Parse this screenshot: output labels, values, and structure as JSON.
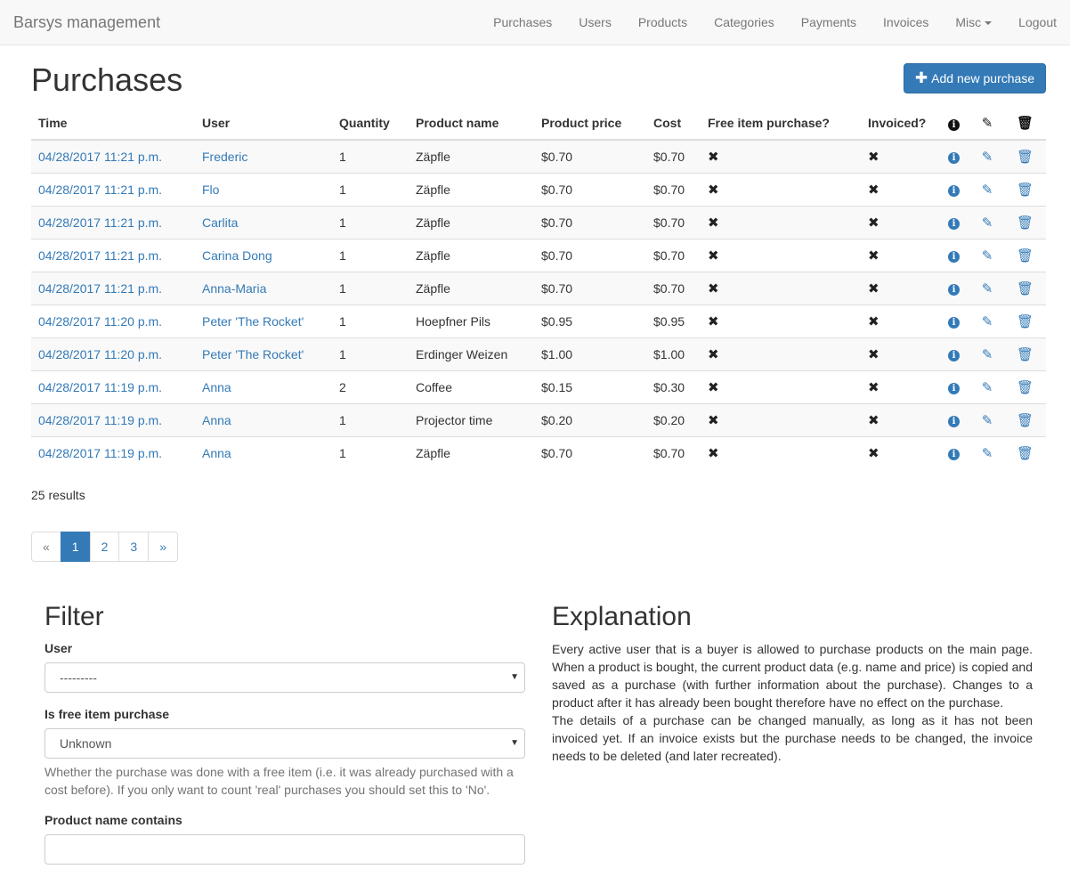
{
  "navbar": {
    "brand": "Barsys management",
    "items": [
      "Purchases",
      "Users",
      "Products",
      "Categories",
      "Payments",
      "Invoices",
      "Misc",
      "Logout"
    ]
  },
  "page": {
    "title": "Purchases",
    "add_button": "Add new purchase"
  },
  "table": {
    "headers": [
      "Time",
      "User",
      "Quantity",
      "Product name",
      "Product price",
      "Cost",
      "Free item purchase?",
      "Invoiced?"
    ],
    "rows": [
      {
        "time": "04/28/2017 11:21 p.m.",
        "user": "Frederic",
        "qty": "1",
        "product": "Zäpfle",
        "price": "$0.70",
        "cost": "$0.70"
      },
      {
        "time": "04/28/2017 11:21 p.m.",
        "user": "Flo",
        "qty": "1",
        "product": "Zäpfle",
        "price": "$0.70",
        "cost": "$0.70"
      },
      {
        "time": "04/28/2017 11:21 p.m.",
        "user": "Carlita",
        "qty": "1",
        "product": "Zäpfle",
        "price": "$0.70",
        "cost": "$0.70"
      },
      {
        "time": "04/28/2017 11:21 p.m.",
        "user": "Carina Dong",
        "qty": "1",
        "product": "Zäpfle",
        "price": "$0.70",
        "cost": "$0.70"
      },
      {
        "time": "04/28/2017 11:21 p.m.",
        "user": "Anna-Maria",
        "qty": "1",
        "product": "Zäpfle",
        "price": "$0.70",
        "cost": "$0.70"
      },
      {
        "time": "04/28/2017 11:20 p.m.",
        "user": "Peter 'The Rocket'",
        "qty": "1",
        "product": "Hoepfner Pils",
        "price": "$0.95",
        "cost": "$0.95"
      },
      {
        "time": "04/28/2017 11:20 p.m.",
        "user": "Peter 'The Rocket'",
        "qty": "1",
        "product": "Erdinger Weizen",
        "price": "$1.00",
        "cost": "$1.00"
      },
      {
        "time": "04/28/2017 11:19 p.m.",
        "user": "Anna",
        "qty": "2",
        "product": "Coffee",
        "price": "$0.15",
        "cost": "$0.30"
      },
      {
        "time": "04/28/2017 11:19 p.m.",
        "user": "Anna",
        "qty": "1",
        "product": "Projector time",
        "price": "$0.20",
        "cost": "$0.20"
      },
      {
        "time": "04/28/2017 11:19 p.m.",
        "user": "Anna",
        "qty": "1",
        "product": "Zäpfle",
        "price": "$0.70",
        "cost": "$0.70"
      }
    ]
  },
  "results_text": "25 results",
  "pagination": [
    "«",
    "1",
    "2",
    "3",
    "»"
  ],
  "filter": {
    "title": "Filter",
    "user_label": "User",
    "user_value": "---------",
    "free_label": "Is free item purchase",
    "free_value": "Unknown",
    "free_help": "Whether the purchase was done with a free item (i.e. it was already purchased with a cost before). If you only want to count 'real' purchases you should set this to 'No'.",
    "product_label": "Product name contains",
    "product_value": ""
  },
  "explanation": {
    "title": "Explanation",
    "p1": "Every active user that is a buyer is allowed to purchase products on the main page. When a product is bought, the current product data (e.g. name and price) is copied and saved as a purchase (with further information about the purchase). Changes to a product after it has already been bought therefore have no effect on the purchase.",
    "p2": "The details of a purchase can be changed manually, as long as it has not been invoiced yet. If an invoice exists but the purchase needs to be changed, the invoice needs to be deleted (and later recreated)."
  }
}
